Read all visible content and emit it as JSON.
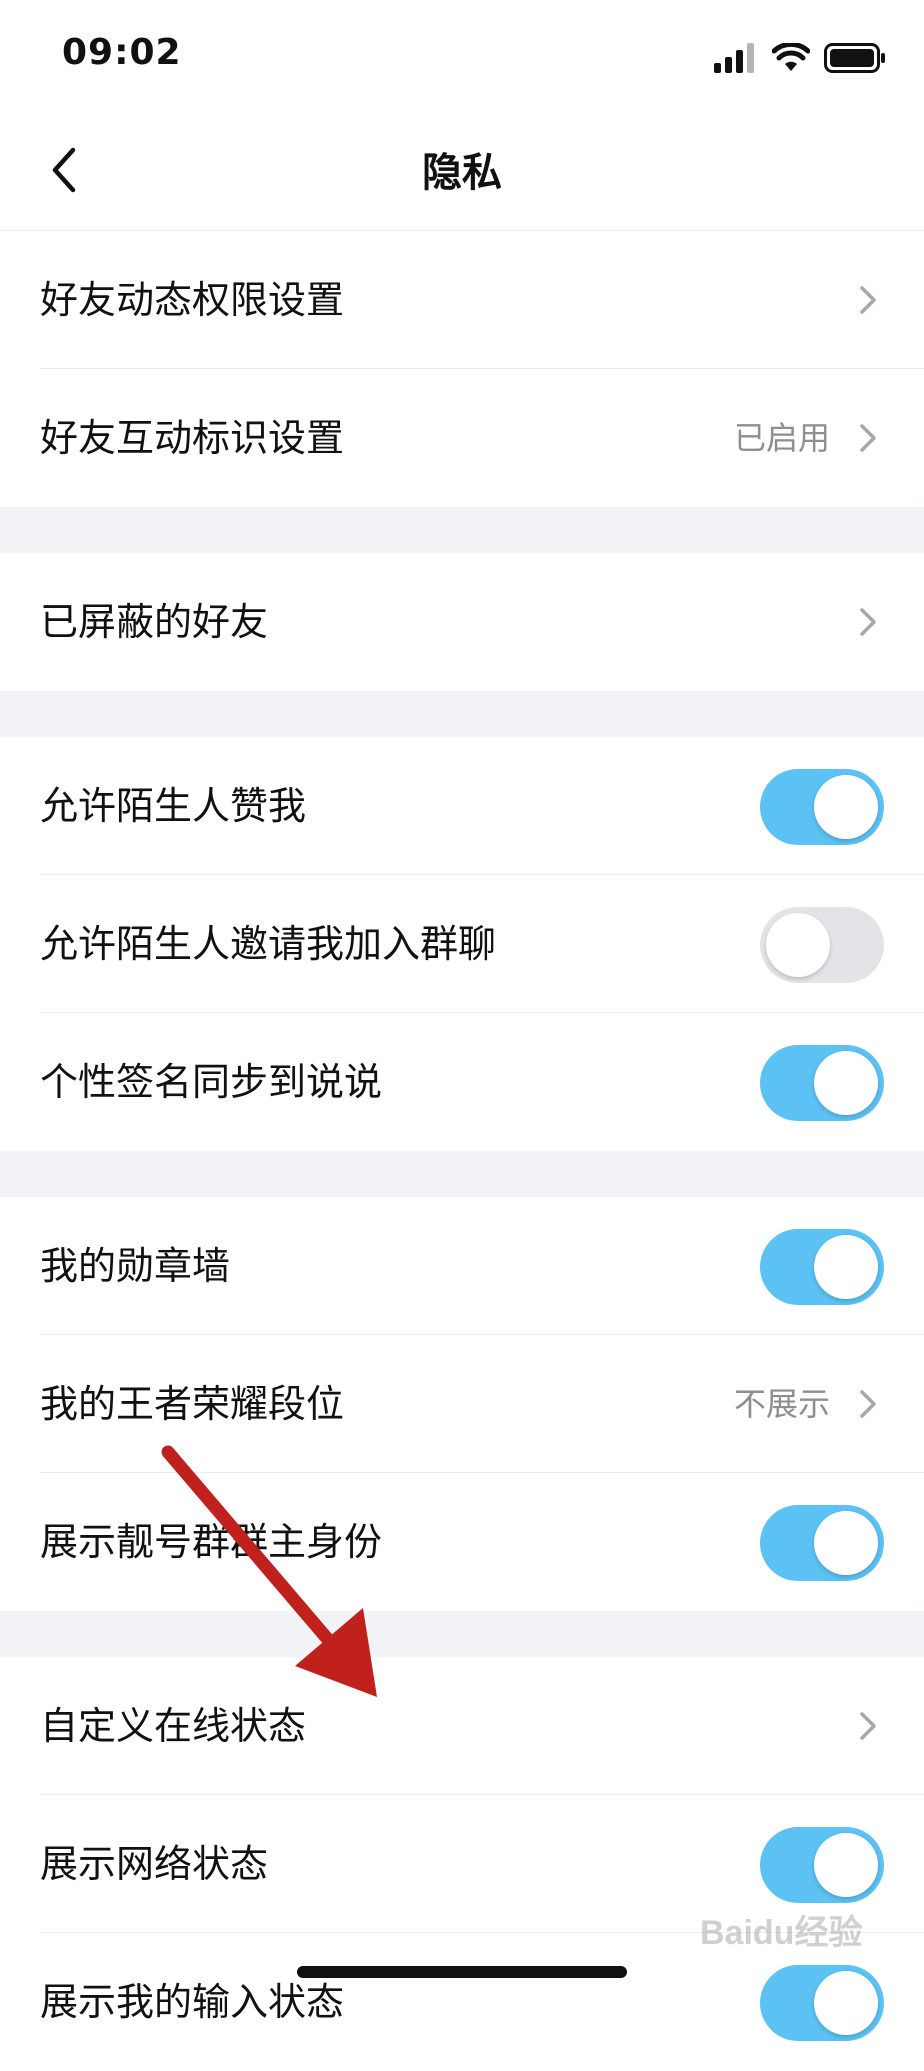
{
  "status_bar": {
    "time": "09:02",
    "icons": [
      "signal-icon",
      "wifi-icon",
      "battery-icon"
    ]
  },
  "header": {
    "back_icon": "chevron-left-icon",
    "title": "隐私"
  },
  "sections": [
    {
      "rows": [
        {
          "label": "好友动态权限设置",
          "kind": "link",
          "value": ""
        },
        {
          "label": "好友互动标识设置",
          "kind": "link",
          "value": "已启用"
        }
      ]
    },
    {
      "rows": [
        {
          "label": "已屏蔽的好友",
          "kind": "link",
          "value": ""
        }
      ]
    },
    {
      "rows": [
        {
          "label": "允许陌生人赞我",
          "kind": "toggle",
          "on": true
        },
        {
          "label": "允许陌生人邀请我加入群聊",
          "kind": "toggle",
          "on": false
        },
        {
          "label": "个性签名同步到说说",
          "kind": "toggle",
          "on": true
        }
      ]
    },
    {
      "rows": [
        {
          "label": "我的勋章墙",
          "kind": "toggle",
          "on": true
        },
        {
          "label": "我的王者荣耀段位",
          "kind": "link",
          "value": "不展示"
        },
        {
          "label": "展示靓号群群主身份",
          "kind": "toggle",
          "on": true
        }
      ]
    },
    {
      "rows": [
        {
          "label": "自定义在线状态",
          "kind": "link",
          "value": ""
        },
        {
          "label": "展示网络状态",
          "kind": "toggle",
          "on": true
        },
        {
          "label": "展示我的输入状态",
          "kind": "toggle",
          "on": true
        }
      ]
    }
  ],
  "colors": {
    "toggle_on": "#5cc1f3",
    "toggle_off": "#e3e4e8",
    "section_gap": "#f2f3f7",
    "secondary_text": "#8d8d93",
    "annotation_arrow": "#c0211c"
  },
  "watermark": "Baidu经验"
}
